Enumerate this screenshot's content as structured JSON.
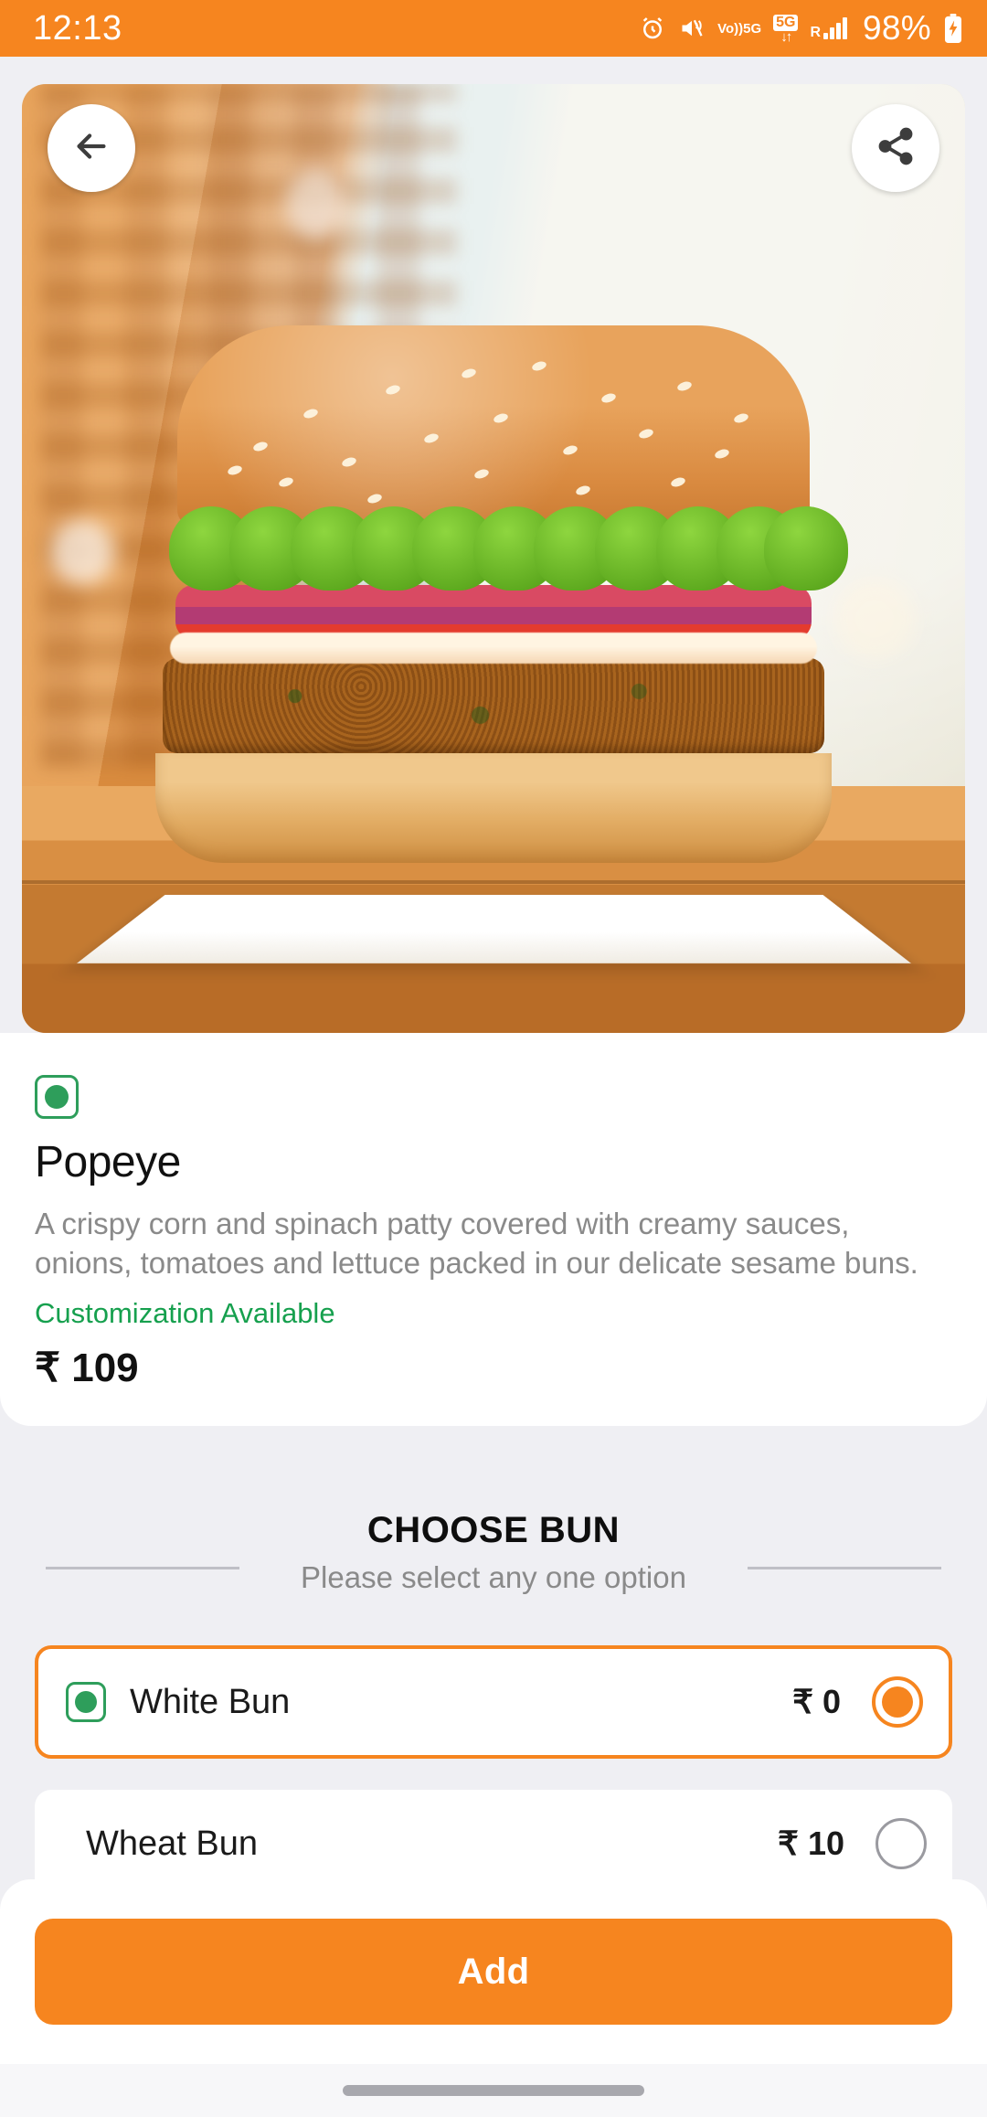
{
  "status_bar": {
    "time": "12:13",
    "battery_percent": "98%",
    "icons": [
      "alarm-icon",
      "mute-icon",
      "volte-5g-icon",
      "5g-data-icon",
      "roaming-signal-icon",
      "battery-charging-icon"
    ],
    "volte_top": "Vo))",
    "volte_bottom": "5G",
    "data_badge": "5G",
    "data_arrows": "↓↑",
    "roaming": "R",
    "background": "#F6851F"
  },
  "hero": {
    "back_icon": "arrow-left-icon",
    "share_icon": "share-icon",
    "alt": "Popeye burger on wooden table"
  },
  "product": {
    "veg_indicator": "veg-icon",
    "title": "Popeye",
    "description": "A crispy corn and spinach patty covered with creamy sauces, onions, tomatoes and lettuce packed in our delicate sesame buns.",
    "customization": "Customization Available",
    "customization_color": "#16A04E",
    "price": "₹ 109"
  },
  "choose_section": {
    "title": "CHOOSE BUN",
    "subtitle": "Please select any one option",
    "options": [
      {
        "label": "White Bun",
        "price": "₹ 0",
        "selected": true,
        "veg": true
      },
      {
        "label": "Wheat Bun",
        "price": "₹ 10",
        "selected": false,
        "veg": false
      }
    ]
  },
  "footer": {
    "add_label": "Add",
    "accent": "#F6851F"
  }
}
